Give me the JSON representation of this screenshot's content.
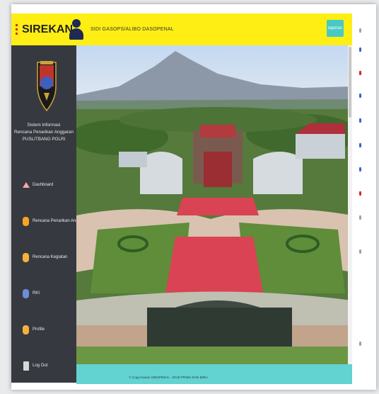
{
  "app": {
    "name": "SIREKAN"
  },
  "header": {
    "user_name": "SIDI GASOPS/ALIBO DASOPENAL",
    "report_label": "laporan"
  },
  "sidebar": {
    "system_title_lines": [
      "Sistem Informasi",
      "Rencana Penarikan Anggaran",
      "PUSLITBANG POLRI"
    ],
    "items": [
      {
        "label": "Dashboard",
        "icon": "home-icon"
      },
      {
        "label": "Rencana Penarikan Anggaran",
        "icon": "document-icon"
      },
      {
        "label": "Rencana Kegiatan",
        "icon": "calendar-icon"
      },
      {
        "label": "RKI",
        "icon": "chart-icon"
      },
      {
        "label": "Profile",
        "icon": "user-icon"
      },
      {
        "label": "Log Out",
        "icon": "logout-icon"
      }
    ]
  },
  "footer": {
    "text": "© Copy Kanan SIDOPENAL - DIVD PRIMA DAN BIRU"
  },
  "colors": {
    "header": "#ffee14",
    "sidebar": "#363a40",
    "footer": "#62d3d1",
    "report_button": "#48c9c3"
  }
}
